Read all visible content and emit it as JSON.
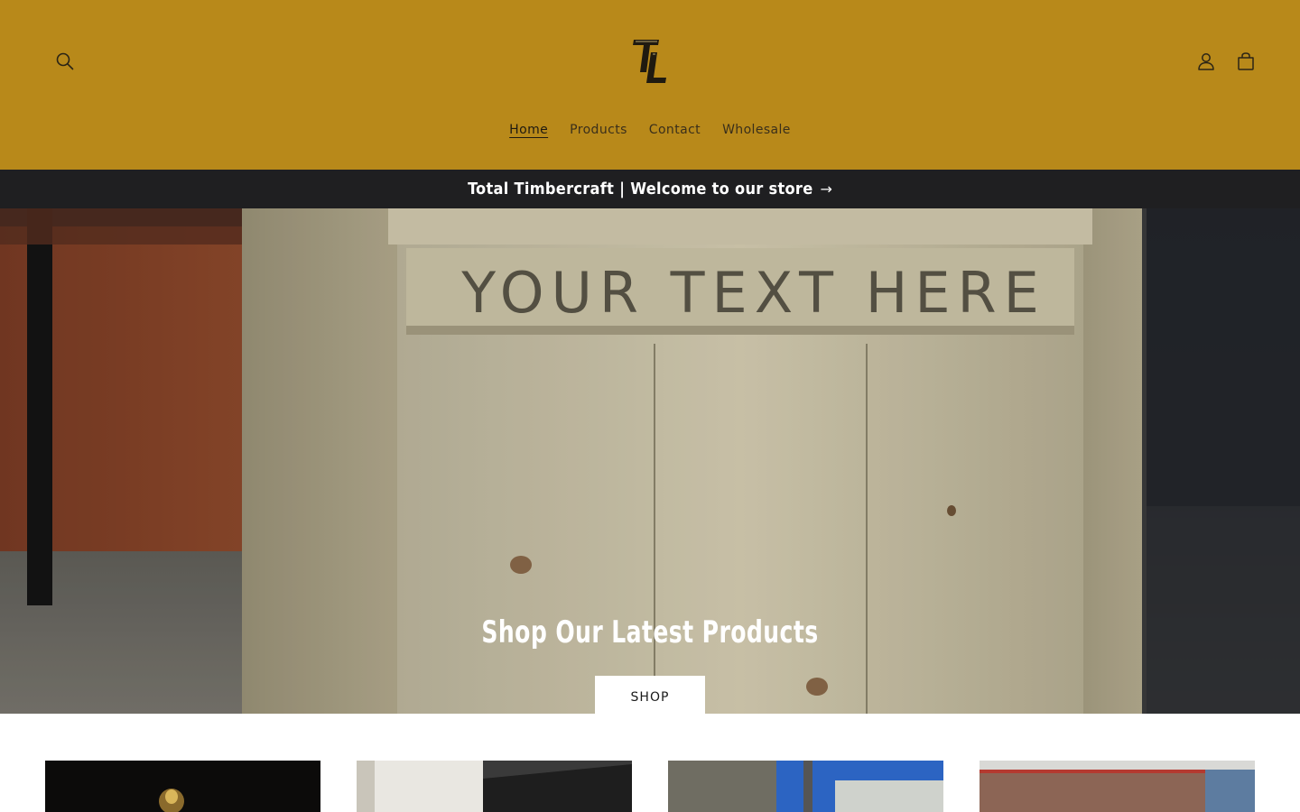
{
  "header": {
    "background": "#b8891a",
    "logo_text": "TL",
    "nav": [
      {
        "label": "Home",
        "active": true
      },
      {
        "label": "Products",
        "active": false
      },
      {
        "label": "Contact",
        "active": false
      },
      {
        "label": "Wholesale",
        "active": false
      }
    ],
    "icons": {
      "search": "search-icon",
      "account": "account-icon",
      "cart": "cart-icon"
    }
  },
  "announcement": {
    "text": "Total Timbercraft | Welcome to our store",
    "arrow": "→",
    "background": "#1f1f21"
  },
  "hero": {
    "engraved_text": "YOUR TEXT HERE",
    "title": "Shop Our Latest Products",
    "button_label": "SHOP"
  },
  "collections": [
    {
      "name": "collection-card-1",
      "tone": "dark"
    },
    {
      "name": "collection-card-2",
      "tone": "light"
    },
    {
      "name": "collection-card-3",
      "tone": "sky"
    },
    {
      "name": "collection-card-4",
      "tone": "brick"
    }
  ]
}
